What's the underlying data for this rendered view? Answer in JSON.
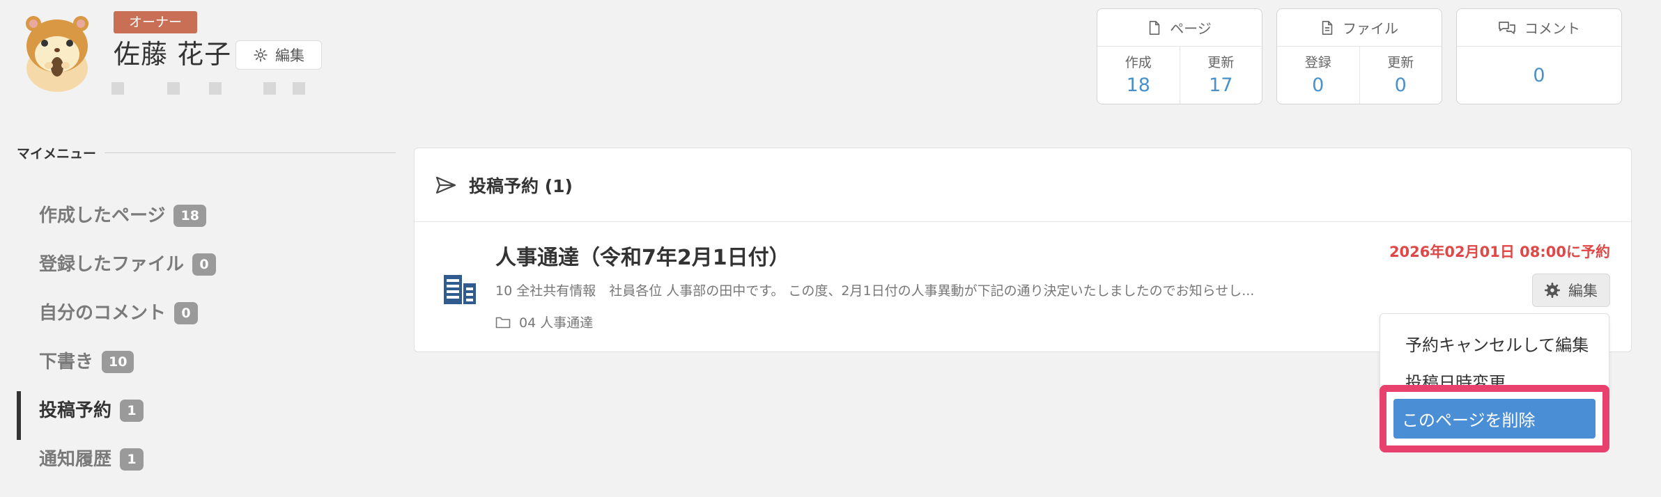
{
  "profile": {
    "badge": "オーナー",
    "name": "佐藤 花子",
    "edit_label": "編集",
    "avatar_icon": "hamster-avatar-icon"
  },
  "stats": {
    "pages": {
      "title": "ページ",
      "created_label": "作成",
      "created_value": "18",
      "updated_label": "更新",
      "updated_value": "17"
    },
    "files": {
      "title": "ファイル",
      "registered_label": "登録",
      "registered_value": "0",
      "updated_label": "更新",
      "updated_value": "0"
    },
    "comments": {
      "title": "コメント",
      "value": "0"
    }
  },
  "menu": {
    "title": "マイメニュー",
    "items": [
      {
        "label": "作成したページ",
        "count": "18"
      },
      {
        "label": "登録したファイル",
        "count": "0"
      },
      {
        "label": "自分のコメント",
        "count": "0"
      },
      {
        "label": "下書き",
        "count": "10"
      },
      {
        "label": "投稿予約",
        "count": "1",
        "active": true
      },
      {
        "label": "通知履歴",
        "count": "1"
      }
    ]
  },
  "panel": {
    "title": "投稿予約 (1)",
    "post": {
      "title": "人事通達（令和7年2月1日付）",
      "schedule": "2026年02月01日 08:00に予約",
      "excerpt": "10 全社共有情報　社員各位 人事部の田中です。 この度、2月1日付の人事異動が下記の通り決定いたしましたのでお知らせし...",
      "folder": "04 人事通達",
      "edit_label": "編集"
    }
  },
  "dropdown": {
    "items": [
      "予約キャンセルして編集",
      "投稿日時変更"
    ],
    "delete_label": "このページを削除"
  },
  "colors": {
    "accent_blue": "#4a90c9",
    "schedule_red": "#e04848",
    "highlight_pink": "#e9416e",
    "owner_badge": "#c96f56"
  }
}
